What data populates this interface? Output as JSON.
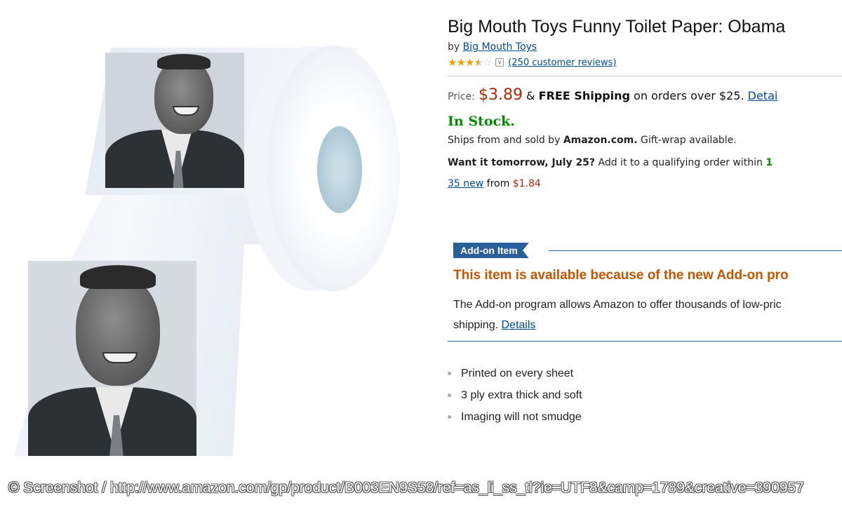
{
  "product": {
    "title": "Big Mouth Toys Funny Toilet Paper: Obama",
    "by_prefix": "by",
    "brand": "Big Mouth Toys",
    "rating": {
      "stars": 3.5,
      "max": 5,
      "reviews_link": "(250 customer reviews)"
    },
    "price": {
      "label": "Price:",
      "amount": "$3.89",
      "shipping_amp": "&",
      "free_shipping": "FREE Shipping",
      "shipping_rest": "on orders over $25.",
      "details_link": "Detai"
    },
    "stock": "In Stock.",
    "ships": {
      "prefix": "Ships from and sold by",
      "seller": "Amazon.com.",
      "suffix": "Gift-wrap available."
    },
    "delivery": {
      "bold": "Want it tomorrow, July 25?",
      "rest": "Add it to a qualifying order within",
      "countdown": "1"
    },
    "offers": {
      "link": "35 new",
      "from": "from",
      "price": "$1.84"
    }
  },
  "addon": {
    "badge": "Add-on Item",
    "title": "This item is available because of the new Add-on pro",
    "line1": "The Add-on program allows Amazon to offer thousands of low-pric",
    "line2_prefix": "shipping.",
    "line2_link": "Details"
  },
  "features": [
    "Printed on every sheet",
    "3 ply extra thick and soft",
    "Imaging will not smudge"
  ],
  "credit": "© Screenshot / http://www.amazon.com/gp/product/B003EN9S58/ref=as_li_ss_tl?ie=UTF8&camp=1789&creative=390957"
}
